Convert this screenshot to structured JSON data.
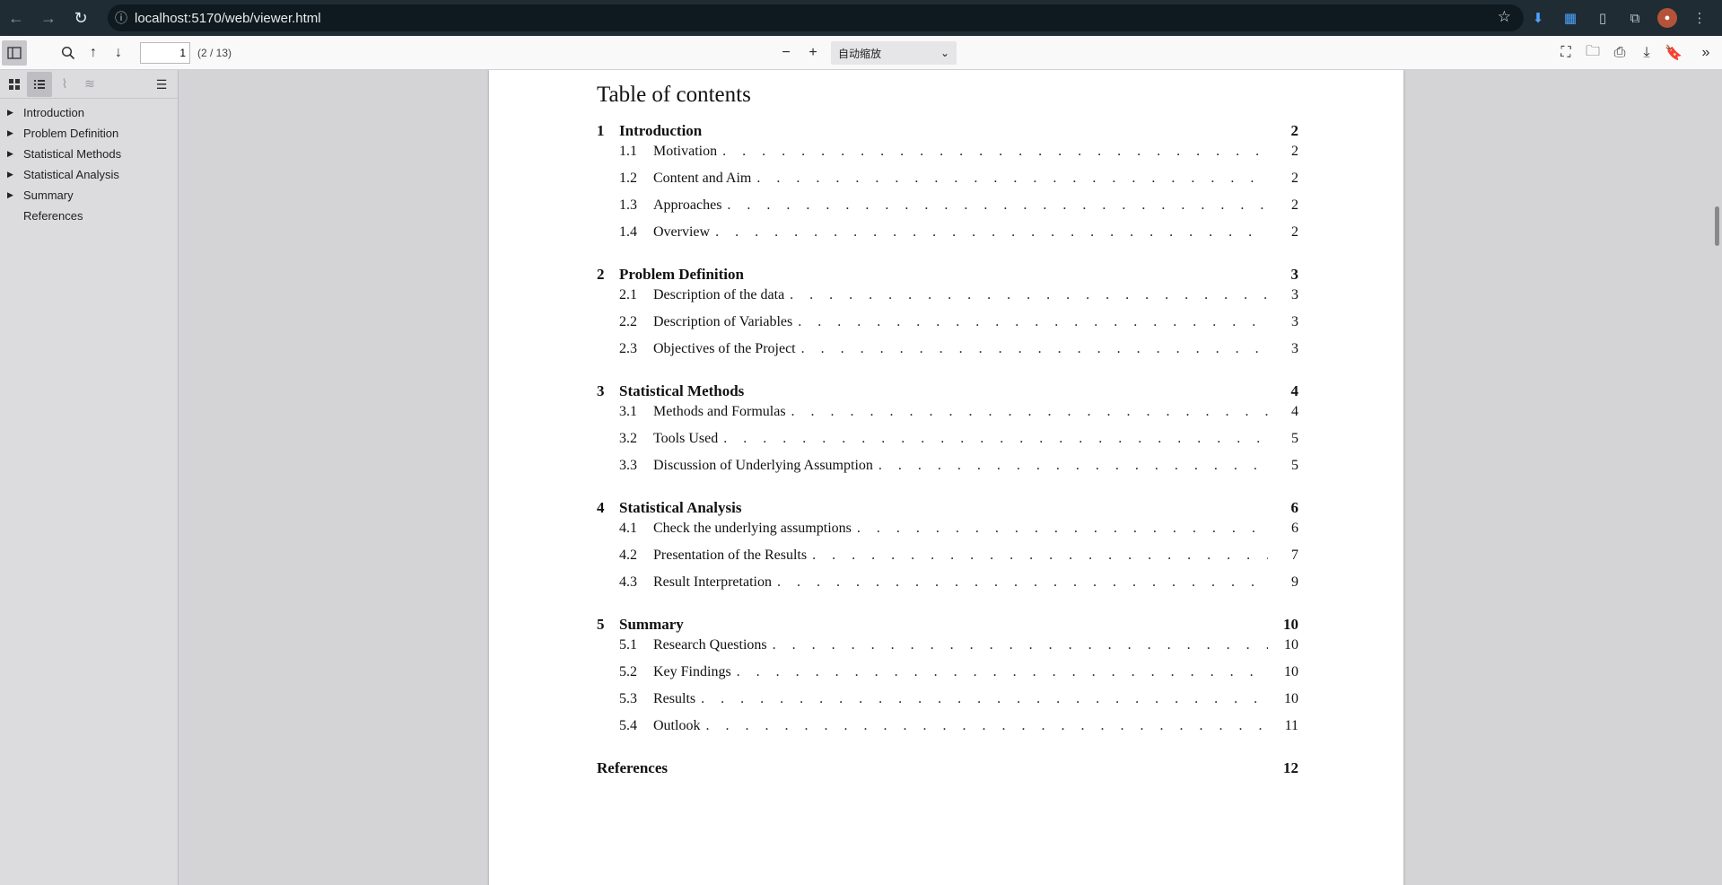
{
  "browser": {
    "url": "localhost:5170/web/viewer.html"
  },
  "toolbar": {
    "page_value": "1",
    "page_count": "(2 / 13)",
    "zoom_minus": "−",
    "zoom_plus": "+",
    "zoom_select": "自动缩放"
  },
  "sidebar": {
    "items": [
      {
        "label": "Introduction",
        "expandable": true
      },
      {
        "label": "Problem Definition",
        "expandable": true
      },
      {
        "label": "Statistical Methods",
        "expandable": true
      },
      {
        "label": "Statistical Analysis",
        "expandable": true
      },
      {
        "label": "Summary",
        "expandable": true
      },
      {
        "label": "References",
        "expandable": false
      }
    ]
  },
  "toc": {
    "title": "Table of contents",
    "sections": [
      {
        "num": "1",
        "title": "Introduction",
        "page": "2",
        "subs": [
          {
            "num": "1.1",
            "title": "Motivation",
            "page": "2"
          },
          {
            "num": "1.2",
            "title": "Content and Aim",
            "page": "2"
          },
          {
            "num": "1.3",
            "title": "Approaches",
            "page": "2"
          },
          {
            "num": "1.4",
            "title": "Overview",
            "page": "2"
          }
        ]
      },
      {
        "num": "2",
        "title": "Problem Definition",
        "page": "3",
        "subs": [
          {
            "num": "2.1",
            "title": "Description of the data",
            "page": "3"
          },
          {
            "num": "2.2",
            "title": "Description of Variables",
            "page": "3"
          },
          {
            "num": "2.3",
            "title": "Objectives of the Project",
            "page": "3"
          }
        ]
      },
      {
        "num": "3",
        "title": "Statistical Methods",
        "page": "4",
        "subs": [
          {
            "num": "3.1",
            "title": "Methods and Formulas",
            "page": "4"
          },
          {
            "num": "3.2",
            "title": "Tools Used",
            "page": "5"
          },
          {
            "num": "3.3",
            "title": "Discussion of Underlying Assumption",
            "page": "5"
          }
        ]
      },
      {
        "num": "4",
        "title": "Statistical Analysis",
        "page": "6",
        "subs": [
          {
            "num": "4.1",
            "title": "Check the underlying assumptions",
            "page": "6"
          },
          {
            "num": "4.2",
            "title": "Presentation of the Results",
            "page": "7"
          },
          {
            "num": "4.3",
            "title": "Result Interpretation",
            "page": "9"
          }
        ]
      },
      {
        "num": "5",
        "title": "Summary",
        "page": "10",
        "subs": [
          {
            "num": "5.1",
            "title": "Research Questions",
            "page": "10"
          },
          {
            "num": "5.2",
            "title": "Key Findings",
            "page": "10"
          },
          {
            "num": "5.3",
            "title": "Results",
            "page": "10"
          },
          {
            "num": "5.4",
            "title": "Outlook",
            "page": "11"
          }
        ]
      }
    ],
    "references": {
      "title": "References",
      "page": "12"
    }
  },
  "colors": {
    "browser_bar": "#1f2c33",
    "toolbar": "#f9f9fa",
    "sidebar": "#dcdcdf",
    "viewer_bg": "#d4d4d7"
  }
}
